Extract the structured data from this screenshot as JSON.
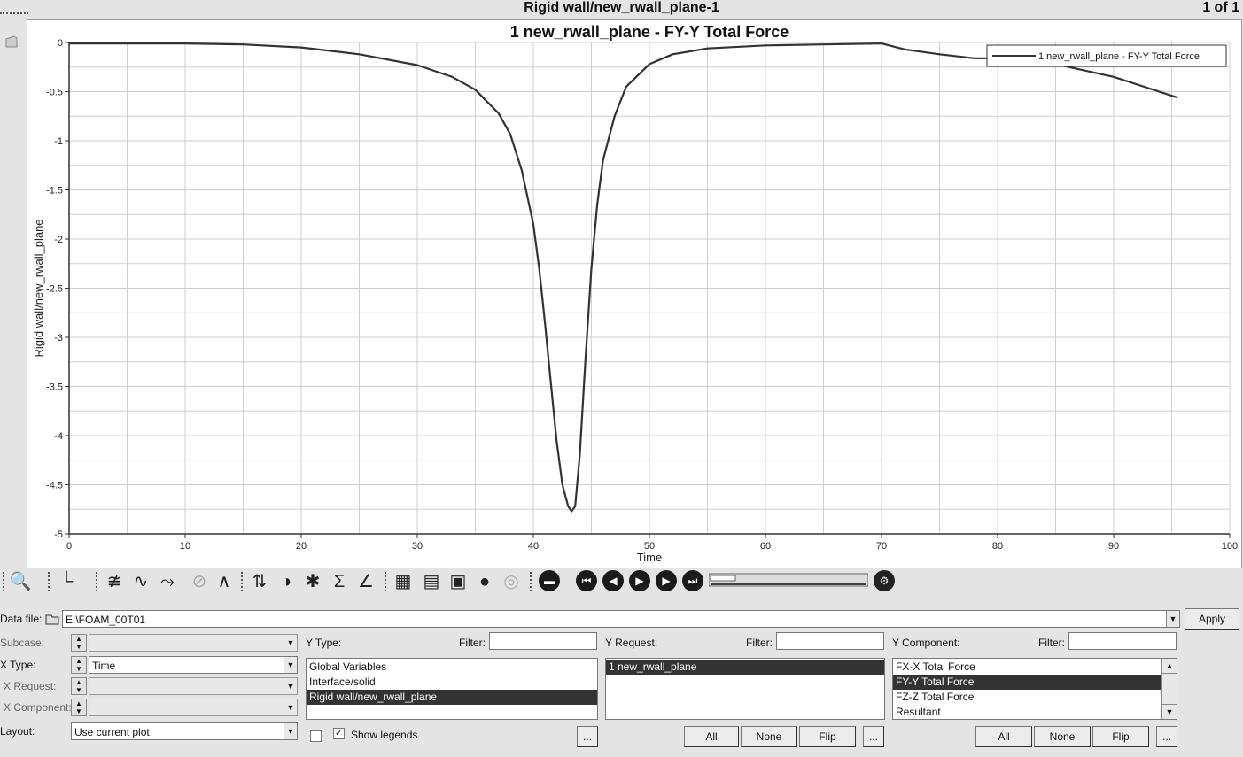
{
  "header": {
    "title": "Rigid wall/new_rwall_plane-1",
    "page_counter": "1 of 1"
  },
  "chart_data": {
    "type": "line",
    "title": "1 new_rwall_plane - FY-Y Total Force",
    "xlabel": "Time",
    "ylabel": "Rigid wall/new_rwall_plane",
    "xlim": [
      0,
      100
    ],
    "ylim": [
      -5,
      0
    ],
    "x_ticks": [
      "0",
      "10",
      "20",
      "30",
      "40",
      "50",
      "60",
      "70",
      "80",
      "90",
      "100"
    ],
    "y_ticks": [
      "0",
      "-0.5",
      "-1",
      "-1.5",
      "-2",
      "-2.5",
      "-3",
      "-3.5",
      "-4",
      "-4.5",
      "-5"
    ],
    "grid": true,
    "legend_position": "top-right",
    "series": [
      {
        "name": "1 new_rwall_plane - FY-Y Total Force",
        "color": "#333333",
        "x": [
          0,
          10,
          15,
          20,
          25,
          30,
          33,
          35,
          37,
          38,
          39,
          40,
          40.5,
          41,
          41.5,
          42,
          42.5,
          43,
          43.3,
          43.6,
          44,
          44.5,
          45,
          45.5,
          46,
          47,
          48,
          50,
          52,
          55,
          60,
          65,
          70,
          72,
          75,
          78,
          80,
          85,
          90,
          95.5
        ],
        "y": [
          -0.01,
          -0.01,
          -0.02,
          -0.05,
          -0.12,
          -0.23,
          -0.35,
          -0.48,
          -0.72,
          -0.93,
          -1.3,
          -1.85,
          -2.3,
          -2.85,
          -3.45,
          -4.05,
          -4.5,
          -4.72,
          -4.77,
          -4.72,
          -4.2,
          -3.2,
          -2.3,
          -1.65,
          -1.2,
          -0.75,
          -0.45,
          -0.22,
          -0.12,
          -0.06,
          -0.03,
          -0.02,
          -0.01,
          -0.07,
          -0.12,
          -0.16,
          -0.16,
          -0.22,
          -0.35,
          -0.56
        ]
      }
    ]
  },
  "toolbar": {
    "icons": [
      "binoculars-icon",
      "axes-icon",
      "curve-edit-icon",
      "math-curve-icon",
      "curve-attr-icon",
      "pin-icon",
      "filter-icon",
      "peak-icon",
      "flip-icon",
      "sphere-icon",
      "crosshair-icon",
      "sum-icon",
      "tangent-icon",
      "grid-icon",
      "table-icon",
      "save-icon",
      "note-icon",
      "globe-icon",
      "stop-icon",
      "first-icon",
      "prev-icon",
      "play-icon",
      "next-icon",
      "last-icon",
      "settings-icon"
    ]
  },
  "panel": {
    "data_file_label": "Data file:",
    "data_file_value": "E:\\FOAM_00T01",
    "apply_label": "Apply",
    "subcase_label": "Subcase:",
    "subcase_value": "",
    "x_type_label": "X Type:",
    "x_type_value": "Time",
    "x_request_label": "X Request:",
    "x_component_label": "X Component:",
    "layout_label": "Layout:",
    "layout_value": "Use current plot",
    "y_type": {
      "label": "Y Type:",
      "filter_label": "Filter:",
      "filter_value": "",
      "items": [
        "Global Variables",
        "Interface/solid",
        "Rigid wall/new_rwall_plane"
      ],
      "selected": 2
    },
    "y_request": {
      "label": "Y Request:",
      "filter_label": "Filter:",
      "filter_value": "",
      "items": [
        "1 new_rwall_plane"
      ],
      "selected": 0
    },
    "y_component": {
      "label": "Y Component:",
      "filter_label": "Filter:",
      "filter_value": "",
      "items": [
        "FX-X Total Force",
        "FY-Y Total Force",
        "FZ-Z Total Force",
        "Resultant"
      ],
      "selected": 1
    },
    "show_legends_label": "Show legends",
    "show_legends_checked": true,
    "more_label": "...",
    "all_label": "All",
    "none_label": "None",
    "flip_label": "Flip"
  }
}
